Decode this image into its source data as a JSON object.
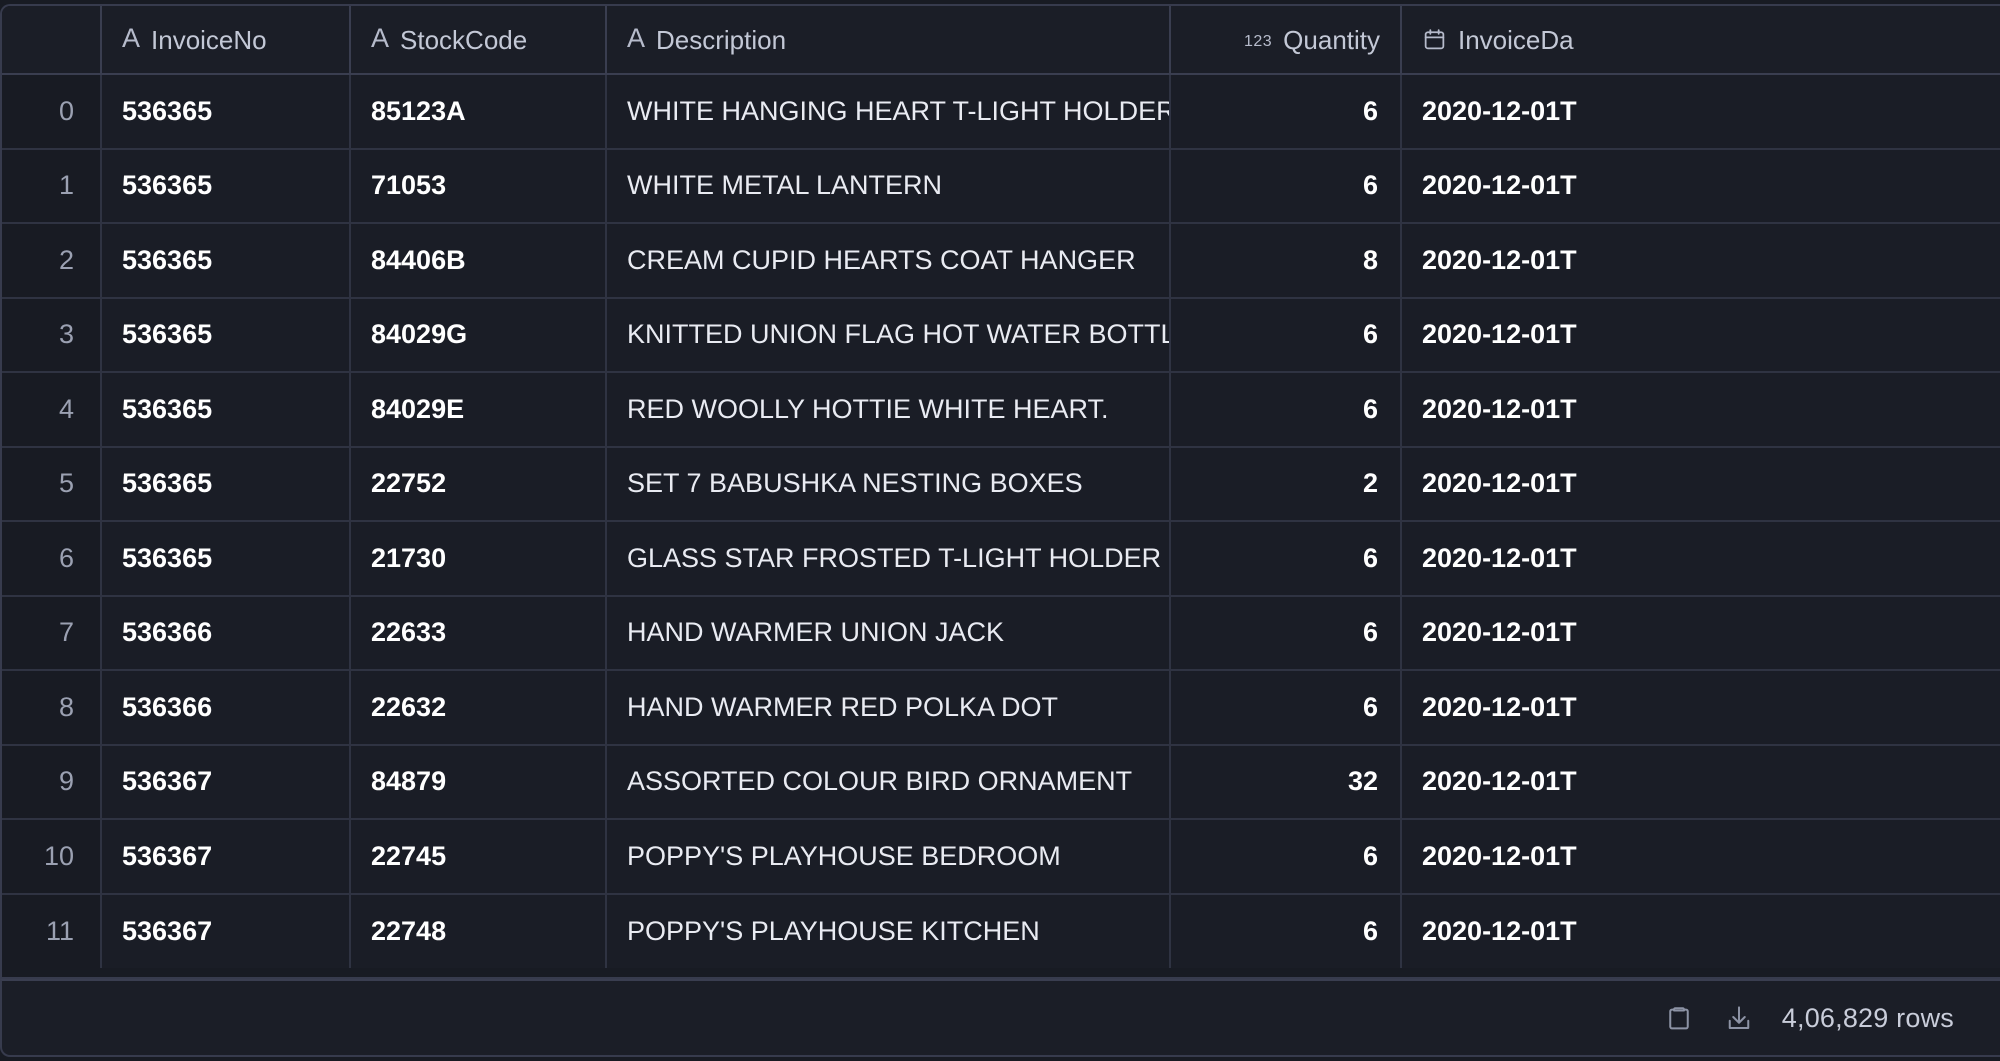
{
  "app": {
    "component": "data-grid",
    "theme": "dark",
    "colors": {
      "background": "#181b23",
      "row_background": "#1a1d26",
      "header_background": "#1b1e27",
      "border": "#2f3342",
      "outer_border": "#373b4d",
      "text_primary": "#ffffff",
      "text_secondary": "#c3c8d6",
      "rownum_text": "#9ba1b2"
    }
  },
  "table": {
    "rownum_header": "",
    "columns": [
      {
        "key": "invoice_no",
        "label": "InvoiceNo",
        "type_icon": "text-type-icon",
        "type_glyph": "A",
        "align": "left"
      },
      {
        "key": "stock_code",
        "label": "StockCode",
        "type_icon": "text-type-icon",
        "type_glyph": "A",
        "align": "left"
      },
      {
        "key": "description",
        "label": "Description",
        "type_icon": "text-type-icon",
        "type_glyph": "A",
        "align": "left"
      },
      {
        "key": "quantity",
        "label": "Quantity",
        "type_icon": "number-type-icon",
        "type_glyph": "123",
        "align": "right"
      },
      {
        "key": "invoice_date",
        "label": "InvoiceDa",
        "type_icon": "calendar-icon",
        "type_glyph": "",
        "align": "left"
      }
    ],
    "rows": [
      {
        "index": "0",
        "invoice_no": "536365",
        "stock_code": "85123A",
        "description": "WHITE HANGING HEART T-LIGHT HOLDER",
        "quantity": "6",
        "invoice_date": "2020-12-01T"
      },
      {
        "index": "1",
        "invoice_no": "536365",
        "stock_code": "71053",
        "description": "WHITE METAL LANTERN",
        "quantity": "6",
        "invoice_date": "2020-12-01T"
      },
      {
        "index": "2",
        "invoice_no": "536365",
        "stock_code": "84406B",
        "description": "CREAM CUPID HEARTS COAT HANGER",
        "quantity": "8",
        "invoice_date": "2020-12-01T"
      },
      {
        "index": "3",
        "invoice_no": "536365",
        "stock_code": "84029G",
        "description": "KNITTED UNION FLAG HOT WATER BOTTLE",
        "quantity": "6",
        "invoice_date": "2020-12-01T"
      },
      {
        "index": "4",
        "invoice_no": "536365",
        "stock_code": "84029E",
        "description": "RED WOOLLY HOTTIE WHITE HEART.",
        "quantity": "6",
        "invoice_date": "2020-12-01T"
      },
      {
        "index": "5",
        "invoice_no": "536365",
        "stock_code": "22752",
        "description": "SET 7 BABUSHKA NESTING BOXES",
        "quantity": "2",
        "invoice_date": "2020-12-01T"
      },
      {
        "index": "6",
        "invoice_no": "536365",
        "stock_code": "21730",
        "description": "GLASS STAR FROSTED T-LIGHT HOLDER",
        "quantity": "6",
        "invoice_date": "2020-12-01T"
      },
      {
        "index": "7",
        "invoice_no": "536366",
        "stock_code": "22633",
        "description": "HAND WARMER UNION JACK",
        "quantity": "6",
        "invoice_date": "2020-12-01T"
      },
      {
        "index": "8",
        "invoice_no": "536366",
        "stock_code": "22632",
        "description": "HAND WARMER RED POLKA DOT",
        "quantity": "6",
        "invoice_date": "2020-12-01T"
      },
      {
        "index": "9",
        "invoice_no": "536367",
        "stock_code": "84879",
        "description": "ASSORTED COLOUR BIRD ORNAMENT",
        "quantity": "32",
        "invoice_date": "2020-12-01T"
      },
      {
        "index": "10",
        "invoice_no": "536367",
        "stock_code": "22745",
        "description": "POPPY'S PLAYHOUSE BEDROOM",
        "quantity": "6",
        "invoice_date": "2020-12-01T"
      },
      {
        "index": "11",
        "invoice_no": "536367",
        "stock_code": "22748",
        "description": "POPPY'S PLAYHOUSE KITCHEN",
        "quantity": "6",
        "invoice_date": "2020-12-01T"
      }
    ]
  },
  "footer": {
    "copy_icon": "clipboard-icon",
    "download_icon": "download-icon",
    "rows_label": "4,06,829 rows"
  }
}
